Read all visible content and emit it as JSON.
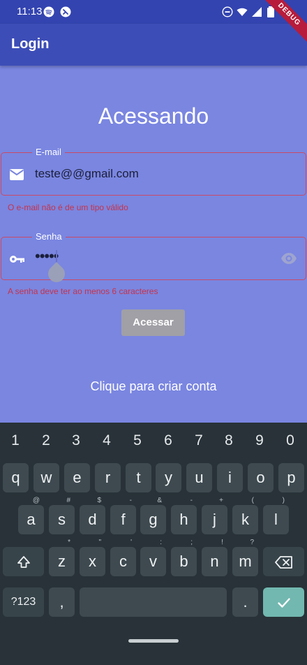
{
  "status_bar": {
    "time": "11:13",
    "debug_label": "DEBUG"
  },
  "app_bar": {
    "title": "Login"
  },
  "heading": "Acessando",
  "email_field": {
    "label": "E-mail",
    "value": "teste@@gmail.com",
    "error": "O e-mail não é de um tipo válido",
    "icon": "mail-icon"
  },
  "password_field": {
    "label": "Senha",
    "value": "•••••",
    "error": "A senha deve ter ao menos 6 caracteres",
    "icon": "key-icon",
    "toggle_icon": "eye-icon"
  },
  "submit_button": {
    "label": "Acessar"
  },
  "create_account_link": {
    "label": "Clique para criar conta"
  },
  "keyboard": {
    "numbers": [
      "1",
      "2",
      "3",
      "4",
      "5",
      "6",
      "7",
      "8",
      "9",
      "0"
    ],
    "row1": [
      "q",
      "w",
      "e",
      "r",
      "t",
      "y",
      "u",
      "i",
      "o",
      "p"
    ],
    "row2": [
      {
        "k": "a",
        "alt": "@"
      },
      {
        "k": "s",
        "alt": "#"
      },
      {
        "k": "d",
        "alt": "$"
      },
      {
        "k": "f",
        "alt": "-"
      },
      {
        "k": "g",
        "alt": "&"
      },
      {
        "k": "h",
        "alt": "-"
      },
      {
        "k": "j",
        "alt": "+"
      },
      {
        "k": "k",
        "alt": "("
      },
      {
        "k": "l",
        "alt": ")"
      }
    ],
    "row3": [
      {
        "k": "z",
        "alt": "*"
      },
      {
        "k": "x",
        "alt": "\""
      },
      {
        "k": "c",
        "alt": "'"
      },
      {
        "k": "v",
        "alt": ":"
      },
      {
        "k": "b",
        "alt": ";"
      },
      {
        "k": "n",
        "alt": "!"
      },
      {
        "k": "m",
        "alt": "?"
      }
    ],
    "symbols_key": "?123",
    "comma_key": ",",
    "period_key": ".",
    "space_key": "",
    "colors": {
      "background": "#283238",
      "key": "#3e4a50",
      "accent": "#72b8b0"
    }
  },
  "colors": {
    "background": "#7a86e0",
    "app_bar": "#3d4db7",
    "status_bar": "#3344b0",
    "error": "#c8324a"
  }
}
